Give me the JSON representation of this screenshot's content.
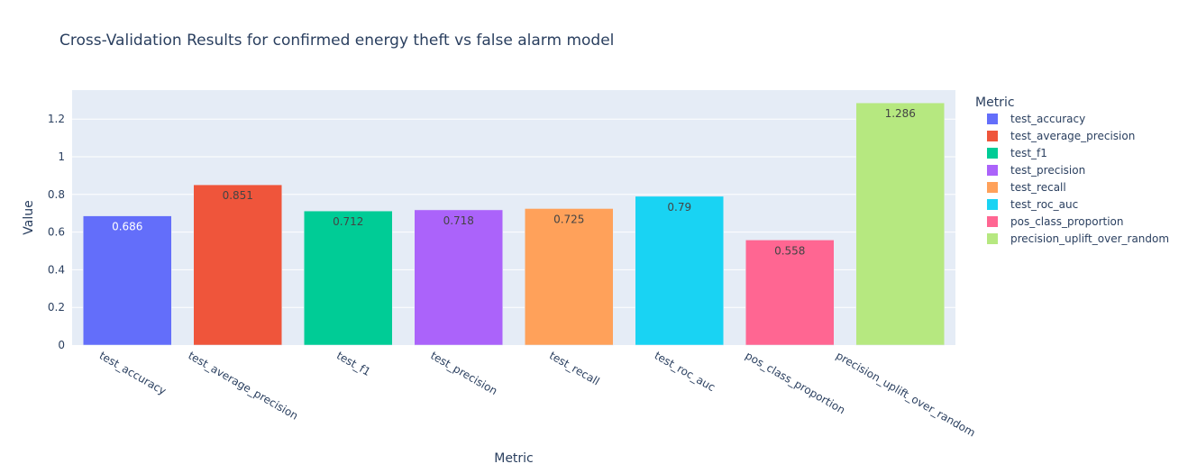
{
  "chart_data": {
    "type": "bar",
    "title": "Cross-Validation Results for confirmed energy theft vs false alarm model",
    "xlabel": "Metric",
    "ylabel": "Value",
    "ylim": [
      0,
      1.354
    ],
    "yticks": [
      0,
      0.2,
      0.4,
      0.6,
      0.8,
      1,
      1.2
    ],
    "ytick_labels": [
      "0",
      "0.2",
      "0.4",
      "0.6",
      "0.8",
      "1",
      "1.2"
    ],
    "grid": true,
    "legend_title": "Metric",
    "legend_position": "right",
    "categories": [
      "test_accuracy",
      "test_average_precision",
      "test_f1",
      "test_precision",
      "test_recall",
      "test_roc_auc",
      "pos_class_proportion",
      "precision_uplift_over_random"
    ],
    "values": [
      0.686,
      0.851,
      0.712,
      0.718,
      0.725,
      0.79,
      0.558,
      1.286
    ],
    "labels": [
      "0.686",
      "0.851",
      "0.712",
      "0.718",
      "0.725",
      "0.79",
      "0.558",
      "1.286"
    ],
    "colors": [
      "#636efa",
      "#EF553B",
      "#00cc96",
      "#ab63fa",
      "#FFA15A",
      "#19d3f3",
      "#FF6692",
      "#B6E880"
    ],
    "label_colors": [
      "#ffffff",
      "#444444",
      "#444444",
      "#444444",
      "#444444",
      "#444444",
      "#444444",
      "#444444"
    ]
  }
}
